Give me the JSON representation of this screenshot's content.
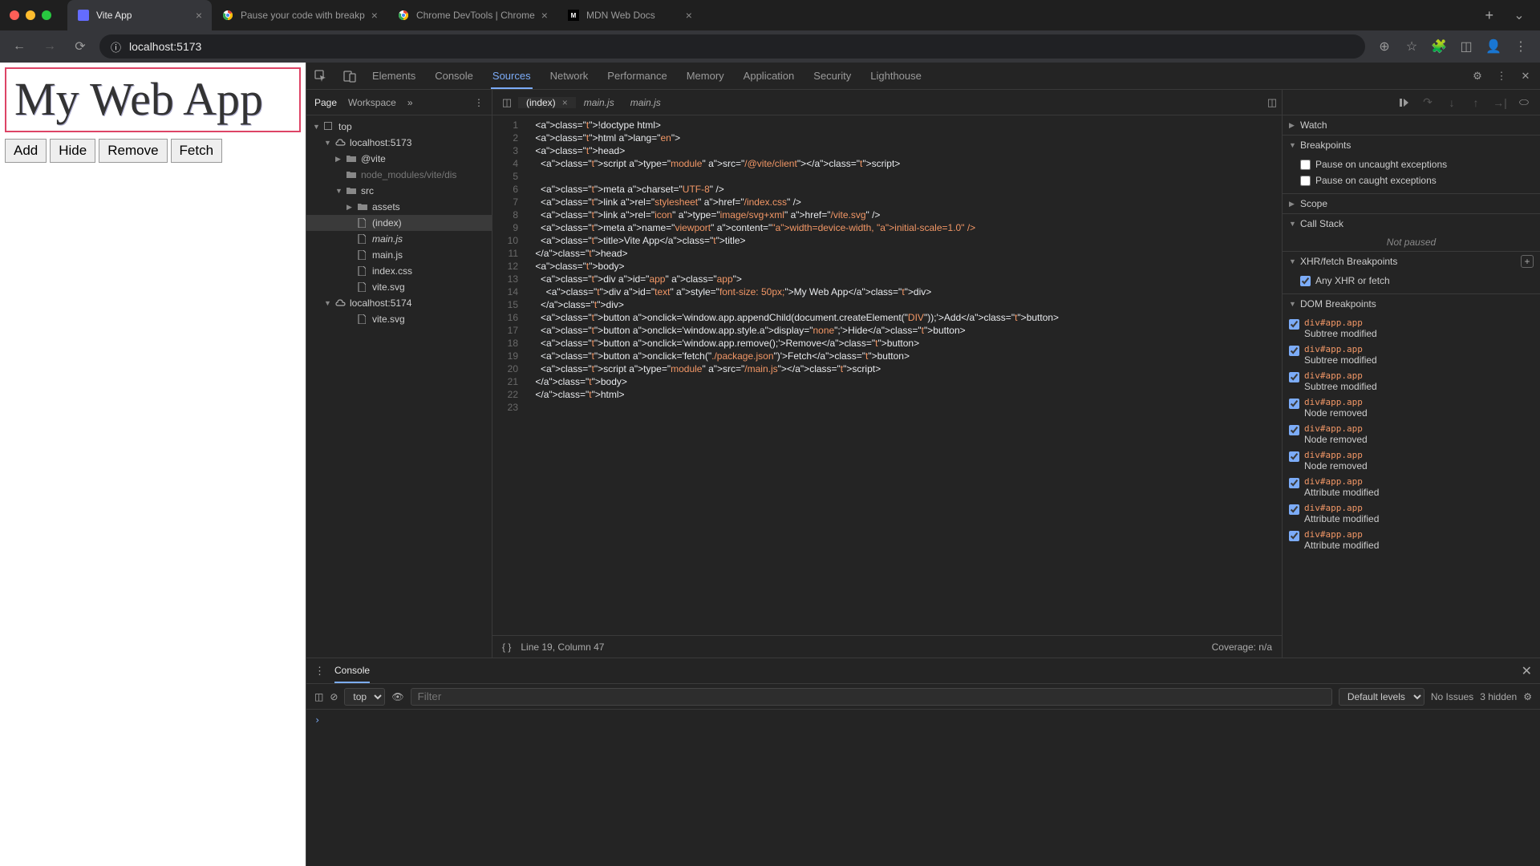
{
  "browser": {
    "tabs": [
      {
        "title": "Vite App",
        "icon_bg": "#646cff",
        "icon_fg": "#fff",
        "active": true
      },
      {
        "title": "Pause your code with breakp",
        "icon_bg": "#fff",
        "icon_fg": "#333",
        "active": false,
        "chrome": true
      },
      {
        "title": "Chrome DevTools | Chrome",
        "icon_bg": "#fff",
        "icon_fg": "#333",
        "active": false,
        "chrome": true
      },
      {
        "title": "MDN Web Docs",
        "icon_bg": "#000",
        "icon_fg": "#fff",
        "active": false,
        "mdn": true
      }
    ],
    "url": "localhost:5173"
  },
  "app": {
    "title": "My Web App",
    "buttons": [
      "Add",
      "Hide",
      "Remove",
      "Fetch"
    ]
  },
  "devtools": {
    "panels": [
      "Elements",
      "Console",
      "Sources",
      "Network",
      "Performance",
      "Memory",
      "Application",
      "Security",
      "Lighthouse"
    ],
    "active_panel_index": 2,
    "sources_tabs": [
      "Page",
      "Workspace"
    ],
    "file_tree": [
      {
        "depth": 0,
        "caret": "▼",
        "ico": "▢",
        "label": "top"
      },
      {
        "depth": 1,
        "caret": "▼",
        "ico": "cloud",
        "label": "localhost:5173"
      },
      {
        "depth": 2,
        "caret": "▶",
        "ico": "folder",
        "label": "@vite"
      },
      {
        "depth": 2,
        "caret": "",
        "ico": "folder",
        "label": "node_modules/vite/dis",
        "dim": true
      },
      {
        "depth": 2,
        "caret": "▼",
        "ico": "folder",
        "label": "src"
      },
      {
        "depth": 3,
        "caret": "▶",
        "ico": "folder",
        "label": "assets"
      },
      {
        "depth": 3,
        "caret": "",
        "ico": "file",
        "label": "(index)",
        "sel": true
      },
      {
        "depth": 3,
        "caret": "",
        "ico": "file",
        "label": "main.js",
        "italic": true
      },
      {
        "depth": 3,
        "caret": "",
        "ico": "file",
        "label": "main.js"
      },
      {
        "depth": 3,
        "caret": "",
        "ico": "file",
        "label": "index.css"
      },
      {
        "depth": 3,
        "caret": "",
        "ico": "file",
        "label": "vite.svg"
      },
      {
        "depth": 1,
        "caret": "▼",
        "ico": "cloud",
        "label": "localhost:5174"
      },
      {
        "depth": 3,
        "caret": "",
        "ico": "file",
        "label": "vite.svg"
      }
    ],
    "editor_tabs": [
      {
        "label": "(index)",
        "active": true
      },
      {
        "label": "main.js",
        "active": false
      },
      {
        "label": "main.js",
        "active": false,
        "italic": true
      }
    ],
    "code_lines": [
      "<!doctype html>",
      "<html lang=\"en\">",
      "<head>",
      "  <script type=\"module\" src=\"/@vite/client\"></script>",
      "",
      "  <meta charset=\"UTF-8\" />",
      "  <link rel=\"stylesheet\" href=\"/index.css\" />",
      "  <link rel=\"icon\" type=\"image/svg+xml\" href=\"/vite.svg\" />",
      "  <meta name=\"viewport\" content=\"width=device-width, initial-scale=1.0\" />",
      "  <title>Vite App</title>",
      "</head>",
      "<body>",
      "  <div id=\"app\" class=\"app\">",
      "    <div id=\"text\" style=\"font-size: 50px;\">My Web App</div>",
      "  </div>",
      "  <button onclick='window.app.appendChild(document.createElement(\"DIV\"));'>Add</button>",
      "  <button onclick='window.app.style.display=\"none\";'>Hide</button>",
      "  <button onclick='window.app.remove();'>Remove</button>",
      "  <button onclick='fetch(\"./package.json\")'>Fetch</button>",
      "  <script type=\"module\" src=\"/main.js\"></script>",
      "</body>",
      "</html>",
      ""
    ],
    "cursor_status": "Line 19, Column 47",
    "coverage": "Coverage: n/a",
    "debugger": {
      "sections": {
        "watch": "Watch",
        "breakpoints": "Breakpoints",
        "scope": "Scope",
        "callstack": "Call Stack",
        "xhr": "XHR/fetch Breakpoints",
        "dom": "DOM Breakpoints"
      },
      "bp_checks": [
        {
          "label": "Pause on uncaught exceptions",
          "checked": false
        },
        {
          "label": "Pause on caught exceptions",
          "checked": false
        }
      ],
      "not_paused": "Not paused",
      "xhr_item": {
        "label": "Any XHR or fetch",
        "checked": true
      },
      "dom_items": [
        {
          "sel": "div#app.app",
          "sub": "Subtree modified"
        },
        {
          "sel": "div#app.app",
          "sub": "Subtree modified"
        },
        {
          "sel": "div#app.app",
          "sub": "Subtree modified"
        },
        {
          "sel": "div#app.app",
          "sub": "Node removed"
        },
        {
          "sel": "div#app.app",
          "sub": "Node removed"
        },
        {
          "sel": "div#app.app",
          "sub": "Node removed"
        },
        {
          "sel": "div#app.app",
          "sub": "Attribute modified"
        },
        {
          "sel": "div#app.app",
          "sub": "Attribute modified"
        },
        {
          "sel": "div#app.app",
          "sub": "Attribute modified"
        }
      ]
    },
    "console": {
      "tab": "Console",
      "context": "top",
      "filter_placeholder": "Filter",
      "levels": "Default levels",
      "issues": "No Issues",
      "hidden": "3 hidden"
    }
  }
}
